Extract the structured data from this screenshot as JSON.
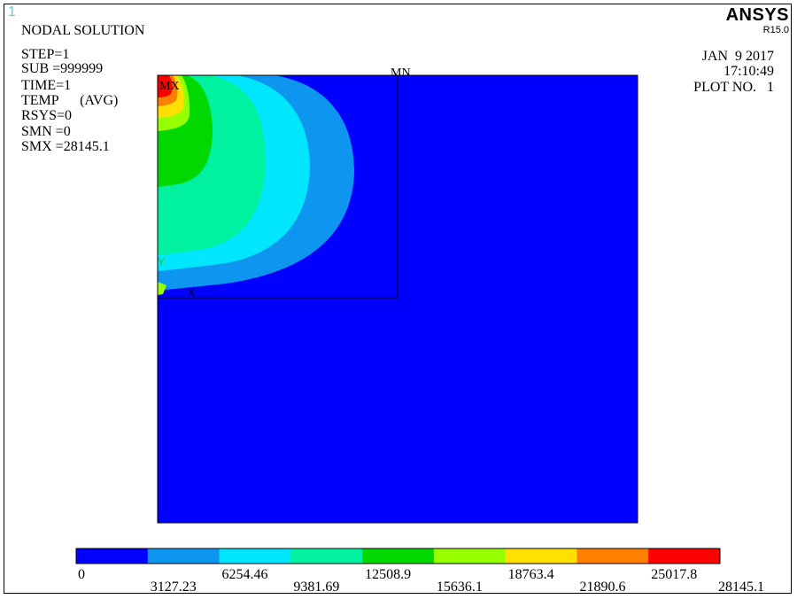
{
  "window_number": "1",
  "brand": {
    "name": "ANSYS",
    "version": "R15.0"
  },
  "info": [
    "NODAL SOLUTION",
    "STEP=1",
    "SUB =999999",
    "TIME=1",
    "TEMP      (AVG)",
    "RSYS=0",
    "SMN =0",
    "SMX =28145.1"
  ],
  "plot_meta": {
    "date": "JAN  9 2017",
    "time": "17:10:49",
    "plot_no": "PLOT NO.   1"
  },
  "markers": {
    "min": "MN",
    "max": "MX",
    "y_axis": "Y",
    "x_axis": "X"
  },
  "legend": {
    "colors": [
      "#0000ff",
      "#0d95f0",
      "#00e6ff",
      "#00f2a0",
      "#00d800",
      "#96ff00",
      "#ffe000",
      "#ff8000",
      "#ff0000"
    ],
    "labels": [
      "0",
      "3127.23",
      "6254.46",
      "9381.69",
      "12508.9",
      "15636.1",
      "18763.4",
      "21890.6",
      "25017.8",
      "28145.1"
    ]
  }
}
